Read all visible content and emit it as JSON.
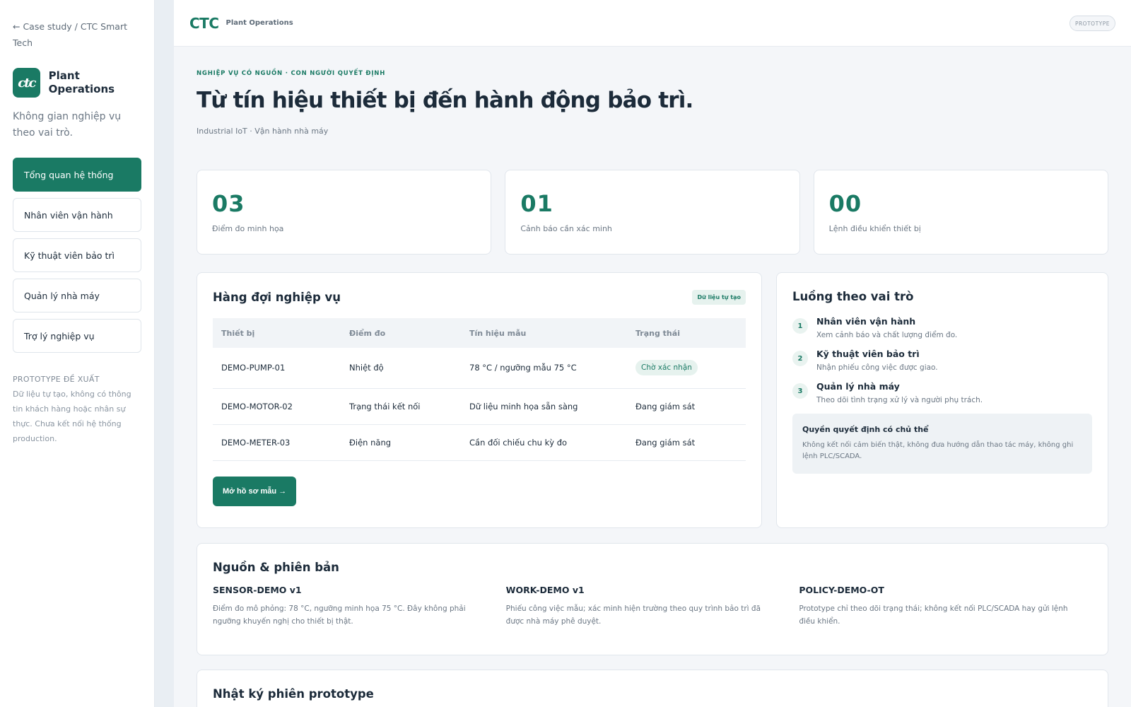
{
  "sidebar": {
    "back_link": "← Case study / CTC Smart Tech",
    "logo_text": "ctc",
    "brand_name": "Plant Operations",
    "tagline": "Không gian nghiệp vụ theo vai trò.",
    "nav": [
      {
        "label": "Tổng quan hệ thống",
        "active": true
      },
      {
        "label": "Nhân viên vận hành"
      },
      {
        "label": "Kỹ thuật viên bảo trì"
      },
      {
        "label": "Quản lý nhà máy"
      },
      {
        "label": "Trợ lý nghiệp vụ"
      }
    ],
    "prototype_title": "PROTOTYPE ĐỀ XUẤT",
    "prototype_note": "Dữ liệu tự tạo, không có thông tin khách hàng hoặc nhân sự thực. Chưa kết nối hệ thống production."
  },
  "topbar": {
    "logo": "CTC",
    "subtitle": "Plant Operations",
    "badge": "PROTOTYPE"
  },
  "header": {
    "eyebrow": "NGHIỆP VỤ CÓ NGUỒN · CON NGƯỜI QUYẾT ĐỊNH",
    "title": "Từ tín hiệu thiết bị đến hành động bảo trì.",
    "subtitle": "Industrial IoT · Vận hành nhà máy"
  },
  "stats": [
    {
      "value": "03",
      "label": "Điểm đo minh họa"
    },
    {
      "value": "01",
      "label": "Cảnh báo cần xác minh"
    },
    {
      "value": "00",
      "label": "Lệnh điều khiển thiết bị"
    }
  ],
  "queue": {
    "title": "Hàng đợi nghiệp vụ",
    "tag": "Dữ liệu tự tạo",
    "columns": [
      "Thiết bị",
      "Điểm đo",
      "Tín hiệu mẫu",
      "Trạng thái"
    ],
    "rows": [
      {
        "device": "DEMO-PUMP-01",
        "point": "Nhiệt độ",
        "signal": "78 °C / ngưỡng mẫu 75 °C",
        "status": "Chờ xác nhận"
      },
      {
        "device": "DEMO-MOTOR-02",
        "point": "Trạng thái kết nối",
        "signal": "Dữ liệu minh họa sẵn sàng",
        "status": "Đang giám sát"
      },
      {
        "device": "DEMO-METER-03",
        "point": "Điện năng",
        "signal": "Cần đối chiếu chu kỳ đo",
        "status": "Đang giám sát"
      }
    ],
    "button": "Mở hồ sơ mẫu →"
  },
  "flow": {
    "title": "Luồng theo vai trò",
    "steps": [
      {
        "num": "1",
        "title": "Nhân viên vận hành",
        "desc": "Xem cảnh báo và chất lượng điểm đo."
      },
      {
        "num": "2",
        "title": "Kỹ thuật viên bảo trì",
        "desc": "Nhận phiếu công việc được giao."
      },
      {
        "num": "3",
        "title": "Quản lý nhà máy",
        "desc": "Theo dõi tình trạng xử lý và người phụ trách."
      }
    ],
    "decision_title": "Quyền quyết định có chủ thể",
    "decision_desc": "Không kết nối cảm biến thật, không đưa hướng dẫn thao tác máy, không ghi lệnh PLC/SCADA."
  },
  "sources": {
    "title": "Nguồn & phiên bản",
    "items": [
      {
        "title": "SENSOR-DEMO v1",
        "desc": "Điểm đo mô phỏng: 78 °C, ngưỡng minh họa 75 °C. Đây không phải ngưỡng khuyến nghị cho thiết bị thật."
      },
      {
        "title": "WORK-DEMO v1",
        "desc": "Phiếu công việc mẫu; xác minh hiện trường theo quy trình bảo trì đã được nhà máy phê duyệt."
      },
      {
        "title": "POLICY-DEMO-OT",
        "desc": "Prototype chỉ theo dõi trạng thái; không kết nối PLC/SCADA hay gửi lệnh điều khiển."
      }
    ]
  },
  "log": {
    "title": "Nhật ký phiên prototype"
  },
  "colors": {
    "accent": "#1a7a64",
    "background": "#f4f6f9",
    "text": "#1c2b3a"
  }
}
